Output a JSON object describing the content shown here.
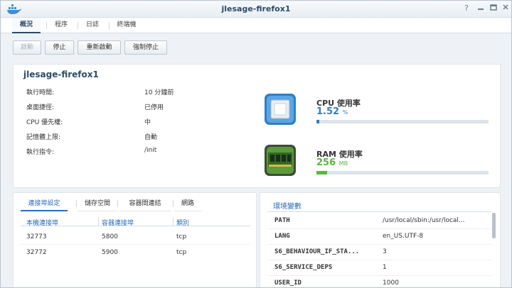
{
  "window": {
    "title": "jlesage-firefox1"
  },
  "tabs": [
    {
      "label": "概況",
      "active": true
    },
    {
      "label": "程序",
      "active": false
    },
    {
      "label": "日誌",
      "active": false
    },
    {
      "label": "終端機",
      "active": false
    }
  ],
  "toolbar": {
    "start": "啟動",
    "stop": "停止",
    "restart": "重新啟動",
    "force_stop": "強制停止"
  },
  "overview": {
    "container_name": "jlesage-firefox1",
    "rows": [
      {
        "label": "執行時間:",
        "value": "10 分鐘前"
      },
      {
        "label": "桌面捷徑:",
        "value": "已停用"
      },
      {
        "label": "CPU 優先權:",
        "value": "中"
      },
      {
        "label": "記憶體上限:",
        "value": "自動"
      },
      {
        "label": "執行指令:",
        "value": "/init"
      }
    ]
  },
  "cpu": {
    "title": "CPU 使用率",
    "value": "1.52",
    "unit": "%",
    "percent": 1.52,
    "color": "#2a7fc1"
  },
  "ram": {
    "title": "RAM 使用率",
    "value": "256",
    "unit": "MB",
    "percent": 6,
    "color": "#58b83c"
  },
  "network": {
    "tabs": [
      {
        "label": "連接埠設定",
        "active": true
      },
      {
        "label": "儲存空間",
        "active": false
      },
      {
        "label": "容器間連結",
        "active": false
      },
      {
        "label": "網路",
        "active": false
      }
    ],
    "headers": [
      "本機連接埠",
      "容器連接埠",
      "類別"
    ],
    "rows": [
      [
        "32773",
        "5800",
        "tcp"
      ],
      [
        "32772",
        "5900",
        "tcp"
      ]
    ]
  },
  "env": {
    "title": "環境變數",
    "rows": [
      {
        "key": "PATH",
        "value": "/usr/local/sbin:/usr/local..."
      },
      {
        "key": "LANG",
        "value": "en_US.UTF-8"
      },
      {
        "key": "S6_BEHAVIOUR_IF_STA...",
        "value": "3"
      },
      {
        "key": "S6_SERVICE_DEPS",
        "value": "1"
      },
      {
        "key": "USER_ID",
        "value": "1000"
      }
    ]
  }
}
